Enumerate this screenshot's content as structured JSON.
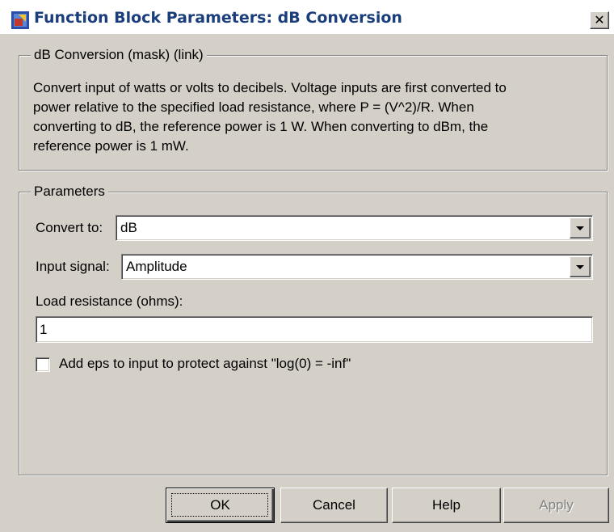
{
  "window": {
    "title": "Function Block Parameters: dB Conversion",
    "close_label": "✕"
  },
  "description": {
    "legend": "dB Conversion (mask) (link)",
    "text_lines": [
      "Convert input of watts or volts to decibels. Voltage inputs are first converted to",
      "power relative to the specified load resistance, where P = (V^2)/R.  When",
      "converting to dB, the reference power is 1 W. When converting to dBm, the",
      "reference power is 1 mW."
    ]
  },
  "parameters": {
    "legend": "Parameters",
    "convert_to": {
      "label": "Convert to:",
      "value": "dB"
    },
    "input_signal": {
      "label": "Input signal:",
      "value": "Amplitude"
    },
    "load_resistance": {
      "label": "Load resistance (ohms):",
      "value": "1"
    },
    "add_eps": {
      "label": "Add eps to input to protect against  \"log(0) = -inf\"",
      "checked": false
    }
  },
  "buttons": {
    "ok": "OK",
    "cancel": "Cancel",
    "help": "Help",
    "apply": "Apply"
  },
  "icons": {
    "app": "simulink-block-icon",
    "close": "close-icon",
    "dropdown": "chevron-down-icon"
  },
  "colors": {
    "dialog_bg": "#d4d0c8",
    "title_text": "#1a3d7c",
    "disabled_text": "#808080"
  }
}
